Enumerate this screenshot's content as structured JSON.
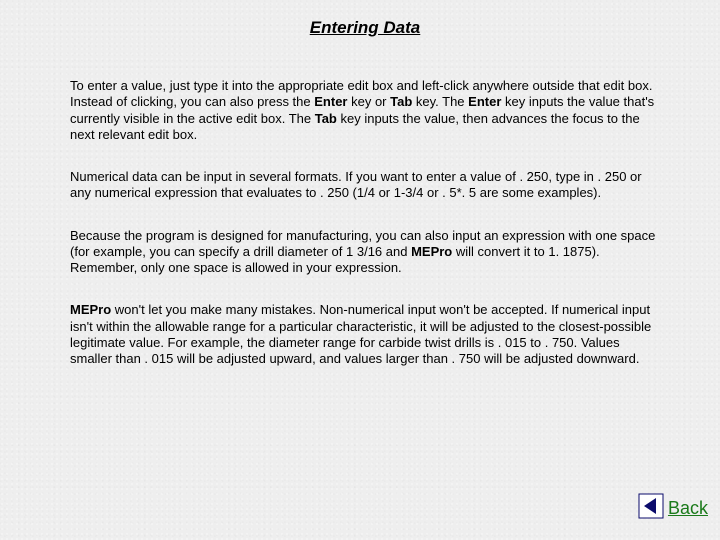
{
  "title": "Entering Data",
  "paragraphs": {
    "p1": {
      "t0": "To enter a value, just type it into the appropriate edit box and left-click anywhere outside that edit box.  Instead of clicking, you can also press the ",
      "enter1": "Enter",
      "t1": " key or ",
      "tab1": "Tab",
      "t2": " key.  The ",
      "enter2": "Enter",
      "t3": " key inputs the value that's currently visible in the active edit box.  The ",
      "tab2": "Tab",
      "t4": " key inputs the value, then advances the focus to the next relevant edit box."
    },
    "p2": "Numerical data can be input in several formats.  If you want to enter a value of . 250, type in . 250 or any numerical expression that evaluates to . 250 (1/4 or 1-3/4 or . 5*. 5 are some examples).",
    "p3": {
      "t0": "Because the program is designed for manufacturing, you can also input an expression with one space (for example, you can specify a drill diameter of 1 3/16 and ",
      "mepro": "MEPro",
      "t1": " will convert it to 1. 1875).  Remember, only one space is allowed in your expression."
    },
    "p4": {
      "mepro": "MEPro",
      "t0": " won't let you make many mistakes.  Non-numerical input won't be accepted.  If numerical input isn't within the allowable range for a particular characteristic, it will be adjusted to the closest-possible legitimate value.   For example, the diameter range for carbide twist drills is . 015 to . 750.  Values smaller than . 015 will be adjusted upward, and values larger than . 750 will be adjusted downward."
    }
  },
  "back_label": "Back"
}
